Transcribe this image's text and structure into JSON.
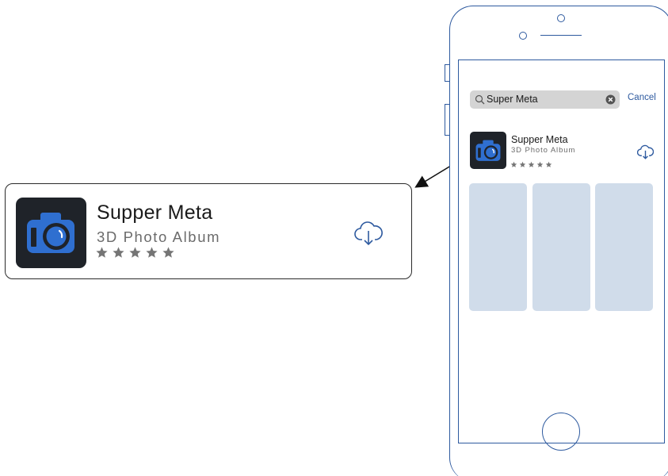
{
  "callout": {
    "app_name": "Supper Meta",
    "app_subtitle": "3D Photo Album",
    "rating_stars": 5,
    "icon": "camera-icon",
    "download_icon": "cloud-download-icon"
  },
  "phone": {
    "search": {
      "query": "Super Meta",
      "icon": "search-icon",
      "clear_icon": "clear-icon"
    },
    "cancel_label": "Cancel",
    "result": {
      "app_name": "Supper Meta",
      "app_subtitle": "3D Photo Album",
      "rating_stars": 5,
      "icon": "camera-icon",
      "download_icon": "cloud-download-icon"
    },
    "screenshots_count": 3
  },
  "colors": {
    "accent": "#2e5a9f",
    "camera_blue": "#2f6fd0",
    "icon_bg": "#1f2329",
    "placeholder": "#d0dcea",
    "search_bg": "#d4d4d4",
    "star": "#757575"
  }
}
